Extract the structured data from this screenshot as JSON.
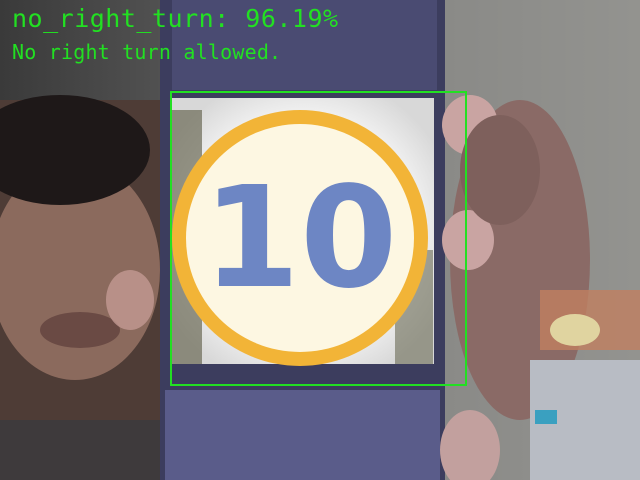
{
  "detection": {
    "title": "no_right_turn: 96.19%",
    "description": "No right turn allowed.",
    "label": "no_right_turn",
    "confidence_percent": 96.19,
    "box_color": "#22e022"
  },
  "sign": {
    "text": "10",
    "ring_color": "#f2b437",
    "text_color": "#6d86c4"
  }
}
